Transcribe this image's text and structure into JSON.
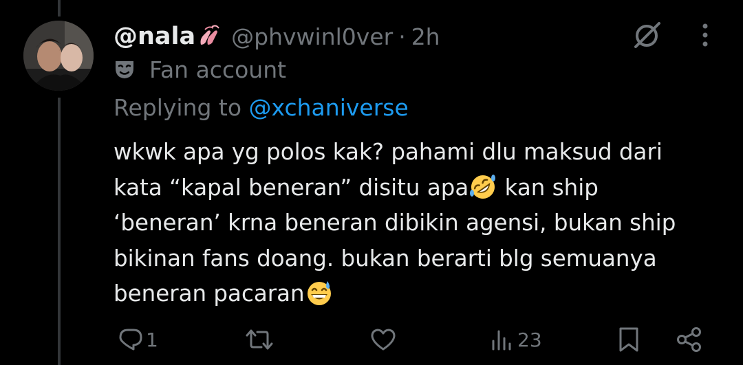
{
  "tweet": {
    "display_name": "@nala",
    "name_emoji": "ballet-shoes-icon",
    "handle": "@phvwinl0ver",
    "separator": "·",
    "time": "2h",
    "badge": {
      "icon": "performing-arts-mask-icon",
      "label": "Fan account"
    },
    "replying_prefix": "Replying to ",
    "replying_handle": "@xchaniverse",
    "body": {
      "line1": "wkwk apa yg polos kak? pahami dlu maksud dari",
      "line2_a": "kata “kapal beneran” disitu apa",
      "line2_b": " kan ship",
      "line3": "‘beneran’ krna beneran dibikin agensi, bukan ship",
      "line4": "bikinan fans doang. bukan berarti blg semuanya",
      "line5": "beneran pacaran",
      "emoji_1": "rolling-on-floor-laughing-icon",
      "emoji_2": "grinning-sweat-icon"
    }
  },
  "actions": {
    "reply_count": "1",
    "retweet_count": "",
    "like_count": "",
    "view_count": "23"
  },
  "colors": {
    "background": "#000000",
    "text_primary": "#e7e9ea",
    "text_secondary": "#71767b",
    "link": "#1d9bf0",
    "thread_line": "#333639"
  }
}
